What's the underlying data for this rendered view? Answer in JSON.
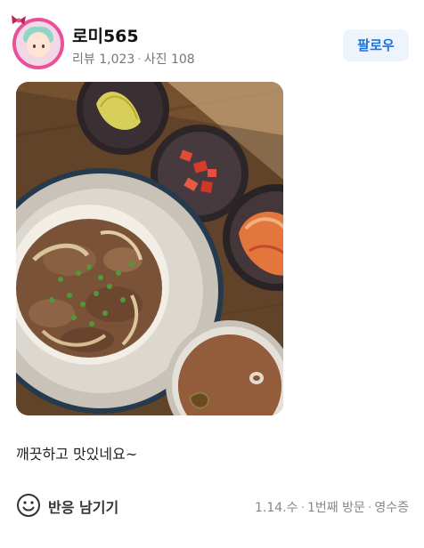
{
  "profile": {
    "nickname": "로미565",
    "review_count_label": "리뷰 1,023",
    "photo_count_label": "사진 108",
    "follow_label": "팔로우"
  },
  "review": {
    "text": "깨끗하고 맛있네요~"
  },
  "footer": {
    "reaction_label": "반응 남기기",
    "date": "1.14.수",
    "visit": "1번째 방문",
    "receipt": "영수증"
  },
  "colors": {
    "accent": "#1a72e8",
    "follow_bg": "#eef4fb",
    "avatar_ring": "#e8509a"
  },
  "icons": [
    "smile-icon",
    "ribbon-icon"
  ]
}
